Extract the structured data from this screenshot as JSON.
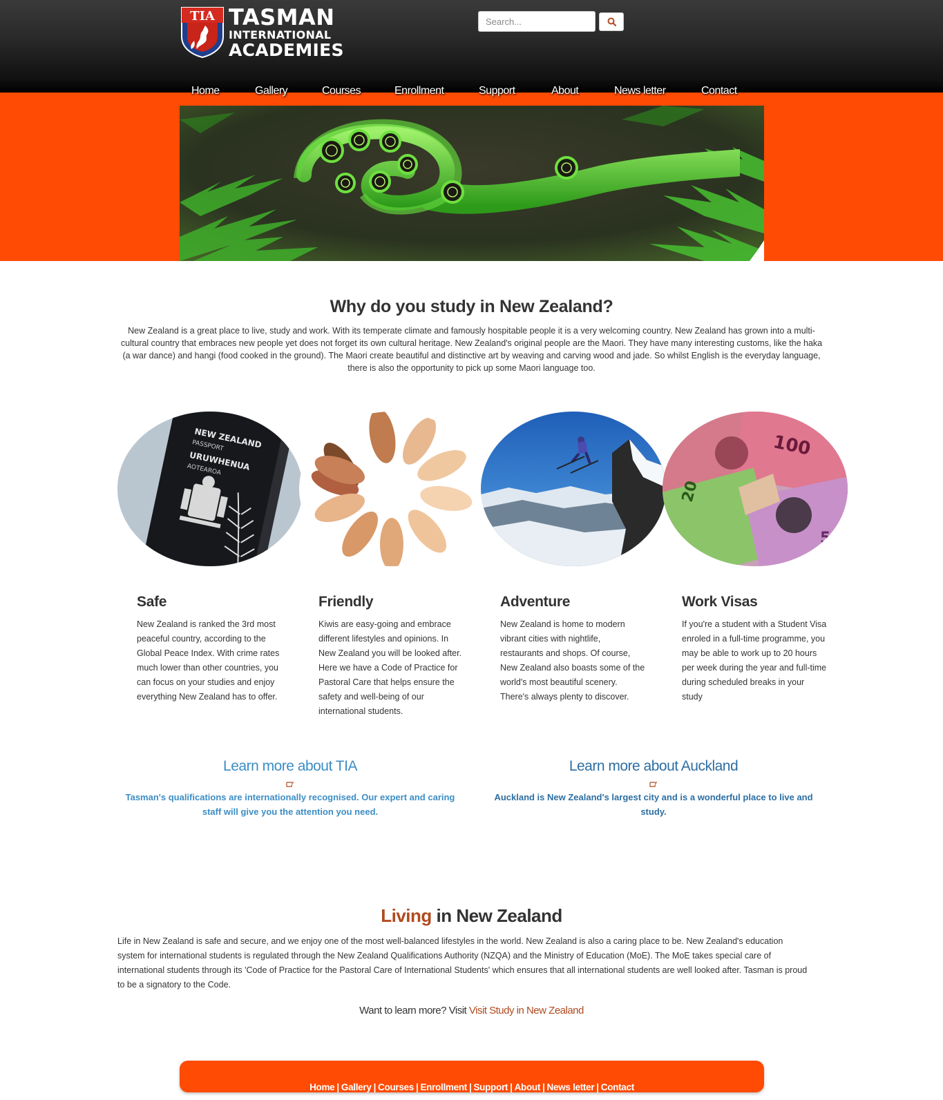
{
  "header": {
    "logo": {
      "badge": "TIA",
      "line1": "TASMAN",
      "line2": "INTERNATIONAL",
      "line3": "ACADEMIES"
    },
    "search": {
      "placeholder": "Search...",
      "button_icon": "search-icon"
    }
  },
  "nav": {
    "items": [
      {
        "label": "Home"
      },
      {
        "label": "Gallery"
      },
      {
        "label": "Courses"
      },
      {
        "label": "Enrollment"
      },
      {
        "label": "Support"
      },
      {
        "label": "About"
      },
      {
        "label": "News letter"
      },
      {
        "label": "Contact"
      }
    ]
  },
  "colors": {
    "brand_orange": "#ff4b03",
    "accent_rust": "#b04a1f",
    "link_blue": "#3c8dc5",
    "link_blue_dark": "#2d6ea2"
  },
  "why": {
    "title": "Why do you study in New Zealand?",
    "text": "New Zealand is a great place to live, study and work. With its temperate climate and famously hospitable people it is a very welcoming country. New Zealand has grown into a multi-cultural country that embraces new people yet does not forget its own cultural heritage. New Zealand's original people are the Maori. They have many interesting customs, like the haka (a war dance) and hangi (food cooked in the ground). The Maori create beautiful and distinctive art by weaving and carving wood and jade. So whilst English is the everyday language, there is also the opportunity to pick up some Maori language too."
  },
  "features": [
    {
      "title": "Safe",
      "text": "New Zealand is ranked the 3rd most peaceful country, according to the Global Peace Index. With crime rates much lower than other countries, you can focus on your studies and enjoy everything New Zealand has to offer."
    },
    {
      "title": "Friendly",
      "text": "Kiwis are easy-going and embrace different lifestyles and opinions. In New Zealand you will be looked after. Here we have a Code of Practice for Pastoral Care that helps ensure the safety and well-being of our international students."
    },
    {
      "title": "Adventure",
      "text": "New Zealand is home to modern vibrant cities with nightlife, restaurants and shops. Of course, New Zealand also boasts some of the world's most beautiful scenery. There's always plenty to discover."
    },
    {
      "title": "Work Visas",
      "text": "If you're a student with a Student Visa enroled in a full-time programme, you may be able to work up to 20 hours per week during the year and full-time during scheduled breaks in your study"
    }
  ],
  "learn": [
    {
      "title": "Learn more about TIA",
      "text": "Tasman's qualifications are internationally recognised. Our expert and caring staff will give you the attention you need."
    },
    {
      "title": "Learn more about Auckland",
      "text": "Auckland is New Zealand's largest city and is a wonderful place to live and study."
    }
  ],
  "living": {
    "title_accent": "Living",
    "title_rest": " in New Zealand",
    "text": "Life in New Zealand is safe and secure, and we enjoy one of the most well-balanced lifestyles in the world. New Zealand is also a caring place to be. New Zealand's education system for international students is regulated through the New Zealand Qualifications Authority (NZQA) and the Ministry of Education (MoE). The MoE takes special care of international students through its 'Code of Practice for the Pastoral Care of International Students' which ensures that all international students are well looked after. Tasman is proud to be a signatory to the Code.",
    "visit_prefix": "Want to learn more? Visit ",
    "visit_link": "Visit Study in New Zealand"
  },
  "footer": {
    "links": [
      "Home",
      "Gallery",
      "Courses",
      "Enrollment",
      "Support",
      "About",
      "News letter",
      "Contact"
    ],
    "separator": "|"
  }
}
